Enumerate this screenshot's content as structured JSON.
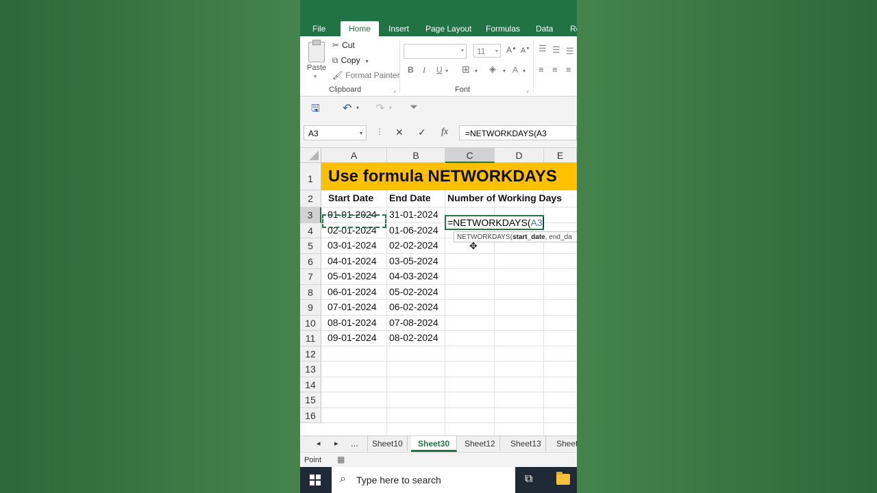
{
  "ribbon_tabs": [
    "File",
    "Home",
    "Insert",
    "Page Layout",
    "Formulas",
    "Data",
    "Re"
  ],
  "clipboard": {
    "paste": "Paste",
    "cut": "Cut",
    "copy": "Copy",
    "format_painter": "Format Painter",
    "group_label": "Clipboard"
  },
  "font": {
    "size": "11",
    "group_label": "Font",
    "bold": "B",
    "italic": "I",
    "underline": "U",
    "grow": "A",
    "shrink": "A",
    "color": "A"
  },
  "formula_bar": {
    "name_box": "A3",
    "fx": "fx",
    "formula": "=NETWORKDAYS(A3"
  },
  "sheet": {
    "columns": [
      "A",
      "B",
      "C",
      "D",
      "E"
    ],
    "rows": [
      "1",
      "2",
      "3",
      "4",
      "5",
      "6",
      "7",
      "8",
      "9",
      "10",
      "11",
      "12",
      "13",
      "14",
      "15",
      "16"
    ],
    "title": "Use formula NETWORKDAYS",
    "headers": [
      "Start Date",
      "End Date",
      "Number of Working Days"
    ],
    "start_dates": [
      "01-01-2024",
      "02-01-2024",
      "03-01-2024",
      "04-01-2024",
      "05-01-2024",
      "06-01-2024",
      "07-01-2024",
      "08-01-2024",
      "09-01-2024"
    ],
    "end_dates": [
      "31-01-2024",
      "01-06-2024",
      "02-02-2024",
      "03-05-2024",
      "04-03-2024",
      "05-02-2024",
      "06-02-2024",
      "07-08-2024",
      "08-02-2024"
    ],
    "active_cell_prefix": "=NETWORKDAYS(",
    "active_cell_ref": "A3",
    "tooltip_fn": "NETWORKDAYS(",
    "tooltip_arg1": "start_date",
    "tooltip_rest": ", end_da"
  },
  "sheet_tabs": {
    "ellipsis": "...",
    "tabs": [
      "Sheet10",
      "Sheet30",
      "Sheet12",
      "Sheet13",
      "Sheet"
    ],
    "active": "Sheet30"
  },
  "status": {
    "mode": "Point"
  },
  "taskbar": {
    "search_placeholder": "Type here to search"
  }
}
